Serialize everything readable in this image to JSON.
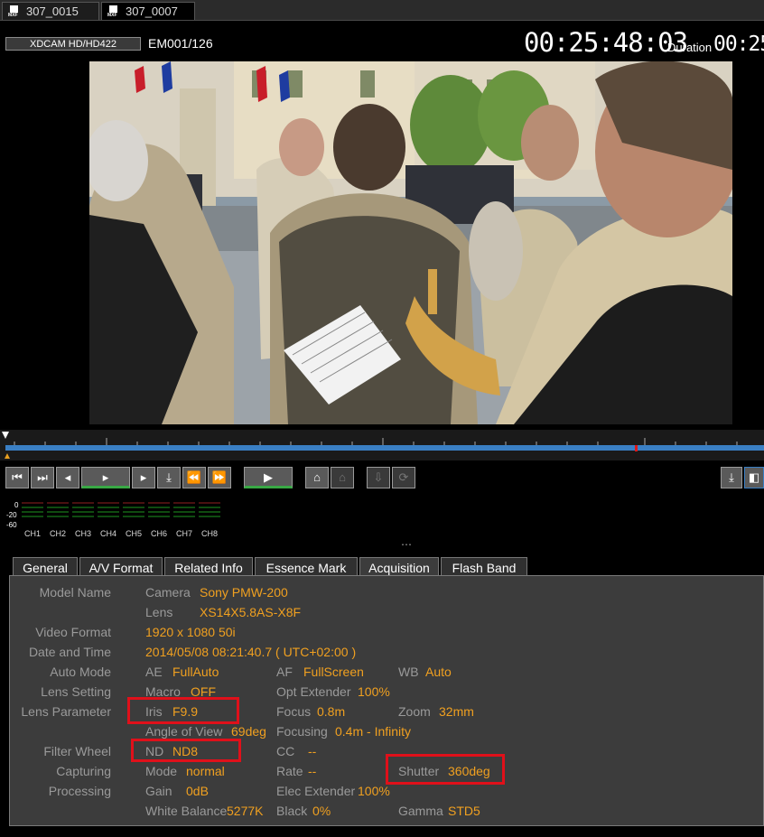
{
  "file_tabs": [
    {
      "icon": "mxf-file-icon",
      "label": "307_0015"
    },
    {
      "icon": "mxf-file-icon",
      "label": "307_0007"
    }
  ],
  "icon_text": "MXF",
  "format": "XDCAM HD/HD422",
  "clip_position": "EM001/126",
  "timecode": "00:25:48:03",
  "duration_label": "Duration",
  "duration_value": "00:25:",
  "transport_icons": [
    "goto-start-icon",
    "goto-end-icon",
    "prev-frame-icon",
    "play-loop-icon",
    "next-frame-icon",
    "mark-clear-icon",
    "prev-mark-icon",
    "next-mark-icon",
    "play-icon",
    "home-icon",
    "home-clear-icon",
    "export-icon",
    "refresh-icon",
    "download-icon",
    "panel-toggle-icon"
  ],
  "meter_scale": [
    "0",
    "-20",
    "-60"
  ],
  "channels": [
    "CH1",
    "CH2",
    "CH3",
    "CH4",
    "CH5",
    "CH6",
    "CH7",
    "CH8"
  ],
  "splitter": "⋯",
  "tabs": [
    "General",
    "A/V Format",
    "Related Info",
    "Essence Mark",
    "Acquisition",
    "Flash Band"
  ],
  "selected_tab": "Acquisition",
  "acq": {
    "model_name": "Model Name",
    "camera_lbl": "Camera",
    "camera": "Sony PMW-200",
    "lens_lbl": "Lens",
    "lens": "XS14X5.8AS-X8F",
    "video_format_lbl": "Video Format",
    "video_format": "1920 x 1080  50i",
    "date_time_lbl": "Date and Time",
    "date_time": "2014/05/08 08:21:40.7 ( UTC+02:00 )",
    "auto_mode_lbl": "Auto Mode",
    "ae_lbl": "AE",
    "ae": "FullAuto",
    "af_lbl": "AF",
    "af": "FullScreen",
    "wb_lbl": "WB",
    "wb": "Auto",
    "lens_setting_lbl": "Lens Setting",
    "macro_lbl": "Macro",
    "macro": "OFF",
    "opt_ext_lbl": "Opt Extender",
    "opt_ext": "100%",
    "lens_param_lbl": "Lens Parameter",
    "iris_lbl": "Iris",
    "iris": "F9.9",
    "focus_lbl": "Focus",
    "focus": "0.8m",
    "zoom_lbl": "Zoom",
    "zoom": "32mm",
    "aov_lbl": "Angle of View",
    "aov": "69deg",
    "focusing_lbl": "Focusing",
    "focusing": "0.4m - Infinity",
    "filter_wheel_lbl": "Filter Wheel",
    "nd_lbl": "ND",
    "nd": "ND8",
    "cc_lbl": "CC",
    "cc": "--",
    "capturing_lbl": "Capturing",
    "mode_lbl": "Mode",
    "mode": "normal",
    "rate_lbl": "Rate",
    "rate": "--",
    "shutter_lbl": "Shutter",
    "shutter": "360deg",
    "processing_lbl": "Processing",
    "gain_lbl": "Gain",
    "gain": "0dB",
    "elec_ext_lbl": "Elec Extender",
    "elec_ext": "100%",
    "wbal_lbl": "White Balance",
    "wbal": "5277K",
    "black_lbl": "Black",
    "black": "0%",
    "gamma_lbl": "Gamma",
    "gamma": "STD5"
  },
  "colors": {
    "value": "#f0a020",
    "label": "#9a9a9a",
    "highlight": "#e0101a",
    "timeline": "#3a7fc4"
  }
}
